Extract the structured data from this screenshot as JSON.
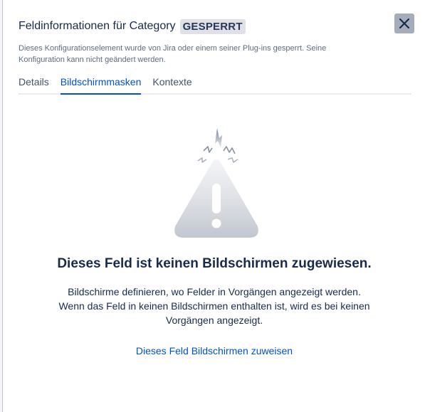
{
  "dialog": {
    "title": "Feldinformationen für Category",
    "badge": "GESPERRT",
    "close_icon": "close-icon",
    "description": "Dieses Konfigurationselement wurde von Jira oder einem seiner Plug-ins gesperrt. Seine Konfiguration kann nicht geändert werden."
  },
  "tabs": [
    {
      "label": "Details",
      "active": false
    },
    {
      "label": "Bildschirmmasken",
      "active": true
    },
    {
      "label": "Kontexte",
      "active": false
    }
  ],
  "empty_state": {
    "icon": "warning-icon",
    "heading": "Dieses Feld ist keinen Bildschirmen zugewiesen.",
    "line1": "Bildschirme definieren, wo Felder in Vorgängen angezeigt werden.",
    "line2": "Wenn das Feld in keinen Bildschirmen enthalten ist, wird es bei keinen",
    "line3": "Vorgängen angezeigt.",
    "link": "Dieses Feld Bildschirmen zuweisen"
  },
  "colors": {
    "link": "#0052cc",
    "text": "#172b4d",
    "badge_bg": "#dfe1e6",
    "close_bg": "#a5adba"
  }
}
